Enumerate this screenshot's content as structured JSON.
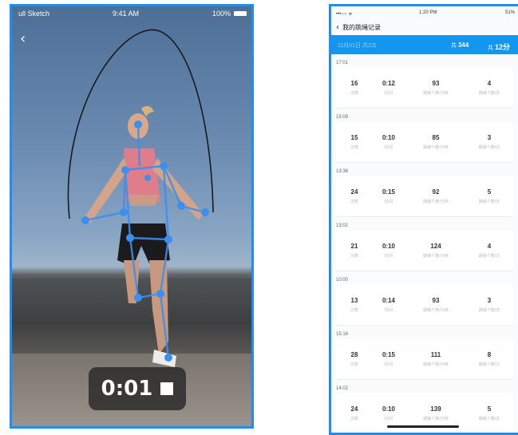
{
  "left_phone": {
    "status": {
      "carrier": "ull Sketch",
      "time": "9:41 AM",
      "battery_text": "100%"
    },
    "back_icon": "chevron-left-icon",
    "timer": {
      "elapsed": "0:01",
      "stop_icon": "stop-icon"
    }
  },
  "right_phone": {
    "status": {
      "carrier": "•••○○ ᯤ",
      "time": "1:20 PM",
      "battery_text": "51%"
    },
    "nav_title": "我的跳绳记录",
    "summary_bar": {
      "left_text": "11月01日 共2次",
      "center_prefix": "共",
      "center_value": "344",
      "right_prefix": "共",
      "right_value": "12分"
    },
    "sections": [
      {
        "time": "17:01",
        "values": [
          "16",
          "0:12",
          "93",
          "4"
        ]
      },
      {
        "time": "15:09",
        "values": [
          "15",
          "0:10",
          "85",
          "3"
        ]
      },
      {
        "time": "13:36",
        "values": [
          "24",
          "0:15",
          "92",
          "5"
        ]
      },
      {
        "time": "13:02",
        "values": [
          "21",
          "0:10",
          "124",
          "4"
        ]
      },
      {
        "time": "10:00",
        "values": [
          "13",
          "0:14",
          "93",
          "3"
        ]
      },
      {
        "time": "15:16",
        "values": [
          "28",
          "0:15",
          "111",
          "8"
        ]
      },
      {
        "time": "14:02",
        "values": [
          "24",
          "0:10",
          "139",
          "5"
        ]
      }
    ],
    "unit_labels": [
      "次数",
      "时间",
      "跳绳个数/分钟",
      "跳绳个数/次"
    ]
  },
  "colors": {
    "accent": "#1296f0",
    "frame": "#1e8ff0",
    "joint": "#3b8ff0"
  }
}
